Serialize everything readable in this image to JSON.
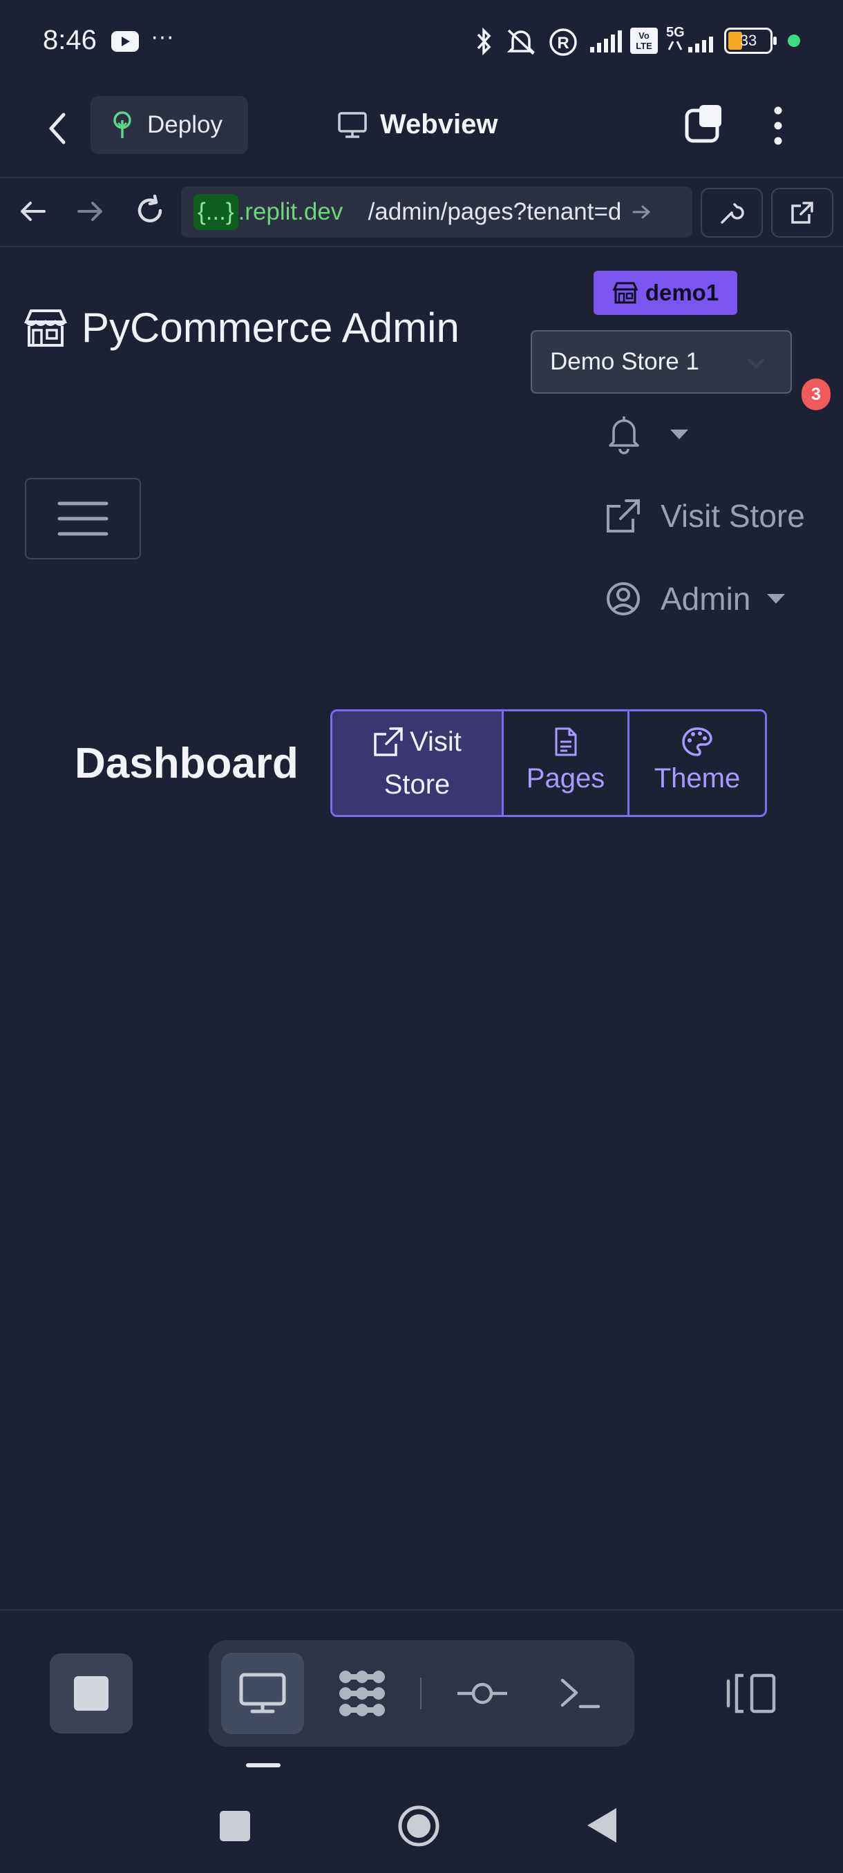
{
  "status_bar": {
    "time": "8:46",
    "more_indicator": "···",
    "battery_level": "33",
    "network_label": "5G",
    "volte_label": "Vo LTE"
  },
  "replit_header": {
    "deploy_label": "Deploy",
    "title": "Webview"
  },
  "address_bar": {
    "url_chip": "{...}",
    "url_domain": ".replit.dev",
    "url_path": "/admin/pages?tenant=d"
  },
  "admin": {
    "tenant_badge": "demo1",
    "brand_title": "PyCommerce Admin",
    "store_select_value": "Demo Store 1",
    "notification_count": "3",
    "visit_store_label": "Visit Store",
    "user_label": "Admin"
  },
  "dashboard": {
    "title": "Dashboard",
    "buttons": [
      {
        "line1": "Visit",
        "line2": "Store",
        "icon": "external-link-icon"
      },
      {
        "line1": "",
        "line2": "Pages",
        "icon": "document-icon"
      },
      {
        "line1": "",
        "line2": "Theme",
        "icon": "palette-icon"
      }
    ]
  },
  "icons": {
    "back": "chevron-left-icon",
    "deploy": "tree-icon",
    "webview": "monitor-icon",
    "tabs": "tabs-icon",
    "menu": "kebab-icon",
    "nav_back": "arrow-left-icon",
    "nav_forward": "arrow-right-icon",
    "reload": "reload-icon",
    "devtools": "wrench-icon",
    "open_external": "external-link-icon"
  },
  "colors": {
    "background": "#1c2233",
    "accent": "#7c6cf1",
    "badge": "#7a55f0",
    "notification": "#ef5b5b",
    "url_green": "#6fd37f"
  }
}
